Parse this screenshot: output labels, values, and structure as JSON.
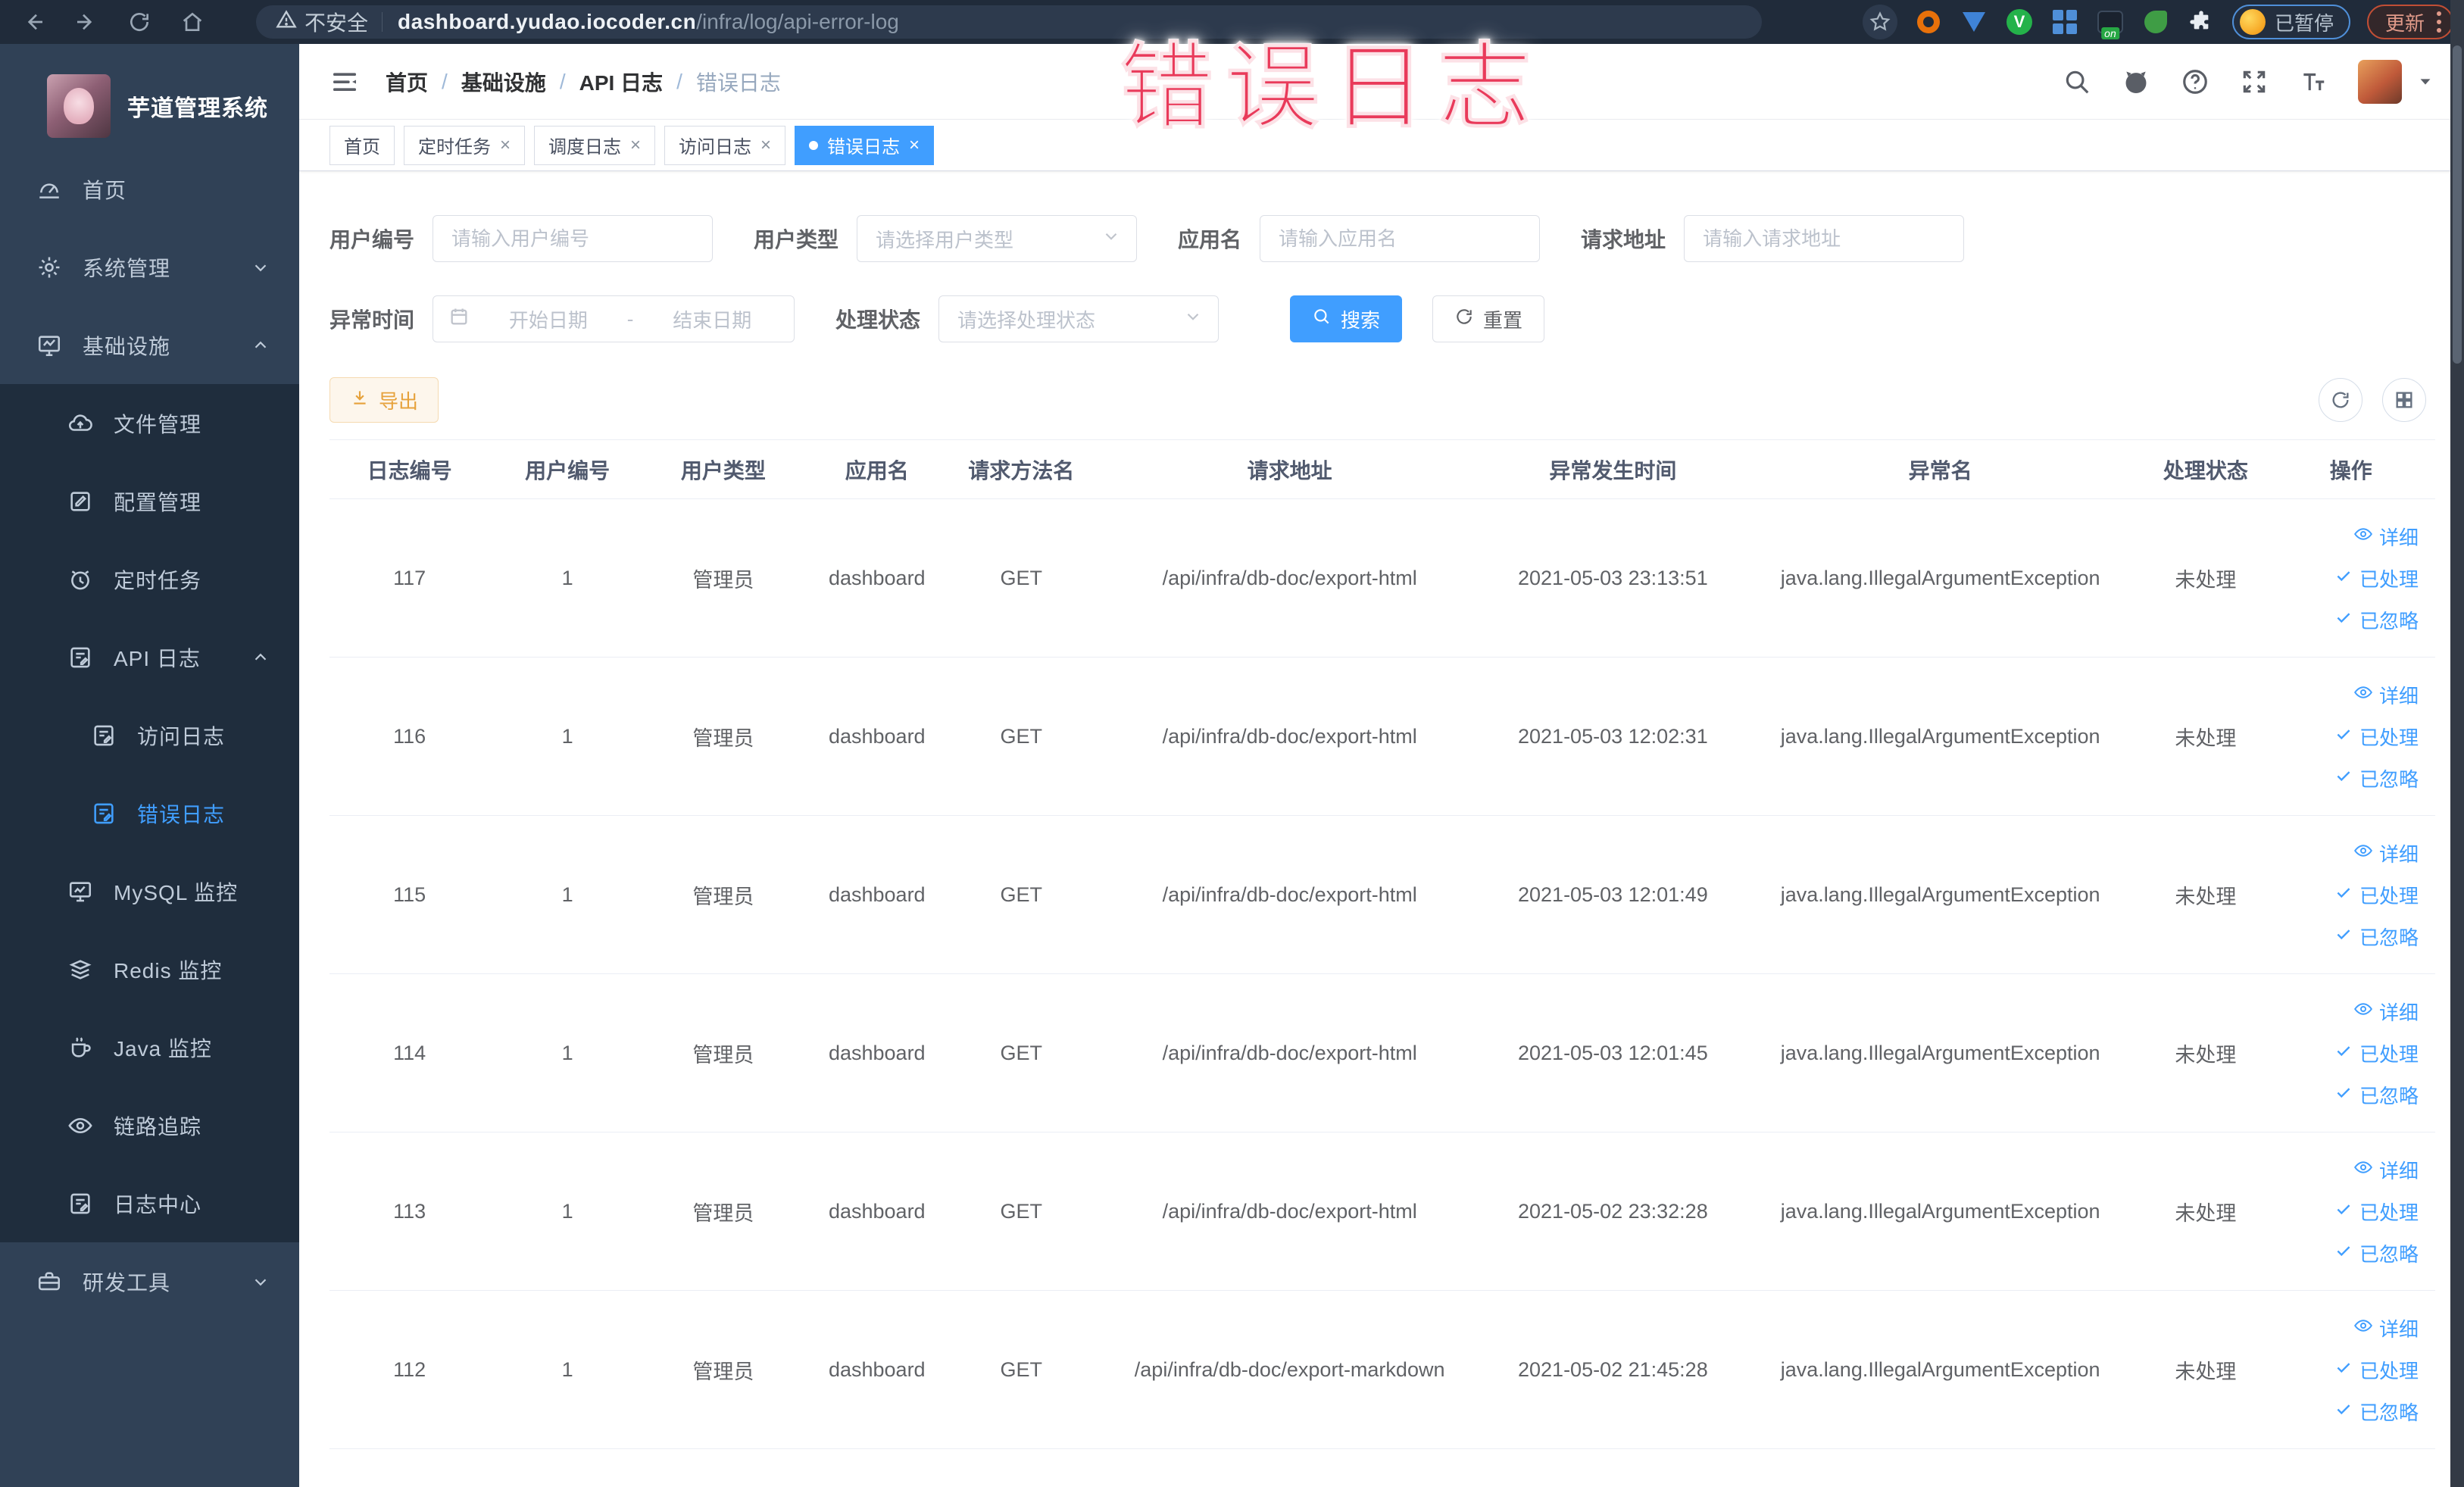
{
  "browser": {
    "security_label": "不安全",
    "url_host": "dashboard.yudao.iocoder.cn",
    "url_path": "/infra/log/api-error-log",
    "paused_label": "已暂停",
    "update_label": "更新"
  },
  "annotation": "错误日志",
  "sidebar": {
    "logo_title": "芋道管理系统",
    "items": [
      {
        "label": "首页",
        "icon": "dashboard-icon",
        "level": 1,
        "dark": false,
        "arrow": null,
        "active": false
      },
      {
        "label": "系统管理",
        "icon": "gear-icon",
        "level": 1,
        "dark": false,
        "arrow": "down",
        "active": false
      },
      {
        "label": "基础设施",
        "icon": "infra-monitor-icon",
        "level": 1,
        "dark": false,
        "arrow": "up",
        "active": false
      },
      {
        "label": "文件管理",
        "icon": "cloud-upload-icon",
        "level": 2,
        "dark": true,
        "arrow": null,
        "active": false
      },
      {
        "label": "配置管理",
        "icon": "edit-icon",
        "level": 2,
        "dark": true,
        "arrow": null,
        "active": false
      },
      {
        "label": "定时任务",
        "icon": "timer-icon",
        "level": 2,
        "dark": true,
        "arrow": null,
        "active": false
      },
      {
        "label": "API 日志",
        "icon": "log-icon",
        "level": 2,
        "dark": true,
        "arrow": "up",
        "active": false
      },
      {
        "label": "访问日志",
        "icon": "log-icon",
        "level": 3,
        "dark": true,
        "arrow": null,
        "active": false
      },
      {
        "label": "错误日志",
        "icon": "log-icon",
        "level": 3,
        "dark": true,
        "arrow": null,
        "active": true
      },
      {
        "label": "MySQL 监控",
        "icon": "monitor-icon",
        "level": 2,
        "dark": true,
        "arrow": null,
        "active": false
      },
      {
        "label": "Redis 监控",
        "icon": "stack-icon",
        "level": 2,
        "dark": true,
        "arrow": null,
        "active": false
      },
      {
        "label": "Java 监控",
        "icon": "java-icon",
        "level": 2,
        "dark": true,
        "arrow": null,
        "active": false
      },
      {
        "label": "链路追踪",
        "icon": "eye-icon",
        "level": 2,
        "dark": true,
        "arrow": null,
        "active": false
      },
      {
        "label": "日志中心",
        "icon": "log-icon",
        "level": 2,
        "dark": true,
        "arrow": null,
        "active": false
      },
      {
        "label": "研发工具",
        "icon": "toolbox-icon",
        "level": 1,
        "dark": false,
        "arrow": "down",
        "active": false
      }
    ]
  },
  "breadcrumb": [
    "首页",
    "基础设施",
    "API 日志",
    "错误日志"
  ],
  "tabs": [
    {
      "label": "首页",
      "closable": false,
      "active": false
    },
    {
      "label": "定时任务",
      "closable": true,
      "active": false
    },
    {
      "label": "调度日志",
      "closable": true,
      "active": false
    },
    {
      "label": "访问日志",
      "closable": true,
      "active": false
    },
    {
      "label": "错误日志",
      "closable": true,
      "active": true
    }
  ],
  "filters": {
    "user_id": {
      "label": "用户编号",
      "placeholder": "请输入用户编号"
    },
    "user_type": {
      "label": "用户类型",
      "placeholder": "请选择用户类型"
    },
    "app_name": {
      "label": "应用名",
      "placeholder": "请输入应用名"
    },
    "request_url": {
      "label": "请求地址",
      "placeholder": "请输入请求地址"
    },
    "exception_time": {
      "label": "异常时间",
      "start_placeholder": "开始日期",
      "separator": "-",
      "end_placeholder": "结束日期"
    },
    "process_status": {
      "label": "处理状态",
      "placeholder": "请选择处理状态"
    },
    "search_label": "搜索",
    "reset_label": "重置"
  },
  "toolbar": {
    "export_label": "导出"
  },
  "table": {
    "columns": [
      "日志编号",
      "用户编号",
      "用户类型",
      "应用名",
      "请求方法名",
      "请求地址",
      "异常发生时间",
      "异常名",
      "处理状态",
      "操作"
    ],
    "actions": [
      {
        "label": "详细",
        "icon": "eye-icon"
      },
      {
        "label": "已处理",
        "icon": "check-icon"
      },
      {
        "label": "已忽略",
        "icon": "check-icon"
      }
    ],
    "rows": [
      {
        "id": "117",
        "user_id": "1",
        "user_type": "管理员",
        "app": "dashboard",
        "method": "GET",
        "url": "/api/infra/db-doc/export-html",
        "time": "2021-05-03 23:13:51",
        "exception": "java.lang.IllegalArgumentException",
        "status": "未处理"
      },
      {
        "id": "116",
        "user_id": "1",
        "user_type": "管理员",
        "app": "dashboard",
        "method": "GET",
        "url": "/api/infra/db-doc/export-html",
        "time": "2021-05-03 12:02:31",
        "exception": "java.lang.IllegalArgumentException",
        "status": "未处理"
      },
      {
        "id": "115",
        "user_id": "1",
        "user_type": "管理员",
        "app": "dashboard",
        "method": "GET",
        "url": "/api/infra/db-doc/export-html",
        "time": "2021-05-03 12:01:49",
        "exception": "java.lang.IllegalArgumentException",
        "status": "未处理"
      },
      {
        "id": "114",
        "user_id": "1",
        "user_type": "管理员",
        "app": "dashboard",
        "method": "GET",
        "url": "/api/infra/db-doc/export-html",
        "time": "2021-05-03 12:01:45",
        "exception": "java.lang.IllegalArgumentException",
        "status": "未处理"
      },
      {
        "id": "113",
        "user_id": "1",
        "user_type": "管理员",
        "app": "dashboard",
        "method": "GET",
        "url": "/api/infra/db-doc/export-html",
        "time": "2021-05-02 23:32:28",
        "exception": "java.lang.IllegalArgumentException",
        "status": "未处理"
      },
      {
        "id": "112",
        "user_id": "1",
        "user_type": "管理员",
        "app": "dashboard",
        "method": "GET",
        "url": "/api/infra/db-doc/export-markdown",
        "time": "2021-05-02 21:45:28",
        "exception": "java.lang.IllegalArgumentException",
        "status": "未处理"
      }
    ]
  },
  "colors": {
    "primary": "#409eff",
    "warning": "#e6a23c",
    "annotation": "#e93a5a",
    "sidebar_bg": "#304156",
    "submenu_bg": "#1f2d3d"
  }
}
